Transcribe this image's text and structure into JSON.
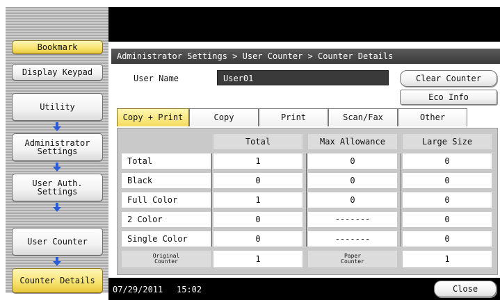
{
  "sidebar": {
    "bookmark": "Bookmark",
    "display_keypad": "Display Keypad",
    "utility": "Utility",
    "administrator_settings": "Administrator\nSettings",
    "user_auth_settings": "User Auth.\nSettings",
    "user_counter": "User Counter",
    "counter_details": "Counter Details"
  },
  "header": {
    "breadcrumb": "Administrator Settings > User Counter > Counter Details"
  },
  "user": {
    "label": "User Name",
    "value": "User01"
  },
  "buttons": {
    "clear_counter": "Clear Counter",
    "eco_info": "Eco Info",
    "close": "Close"
  },
  "tabs": [
    "Copy + Print",
    "Copy",
    "Print",
    "Scan/Fax",
    "Other"
  ],
  "table": {
    "columns": [
      "Total",
      "Max Allowance",
      "Large Size"
    ],
    "rows": [
      {
        "label": "Total",
        "total": "1",
        "max": "0",
        "large": "0"
      },
      {
        "label": "Black",
        "total": "0",
        "max": "0",
        "large": "0"
      },
      {
        "label": "Full Color",
        "total": "1",
        "max": "0",
        "large": "0"
      },
      {
        "label": "2 Color",
        "total": "0",
        "max": "-------",
        "large": "0"
      },
      {
        "label": "Single Color",
        "total": "0",
        "max": "-------",
        "large": "0"
      }
    ],
    "original_counter_label": "Original\nCounter",
    "original_counter_value": "1",
    "paper_counter_label": "Paper\nCounter",
    "paper_counter_value": "1"
  },
  "status": {
    "date": "07/29/2011",
    "time": "15:02"
  },
  "colors": {
    "active_yellow": "#f5dd60",
    "arrow_blue": "#2a5cd8",
    "bar_black": "#000000"
  }
}
